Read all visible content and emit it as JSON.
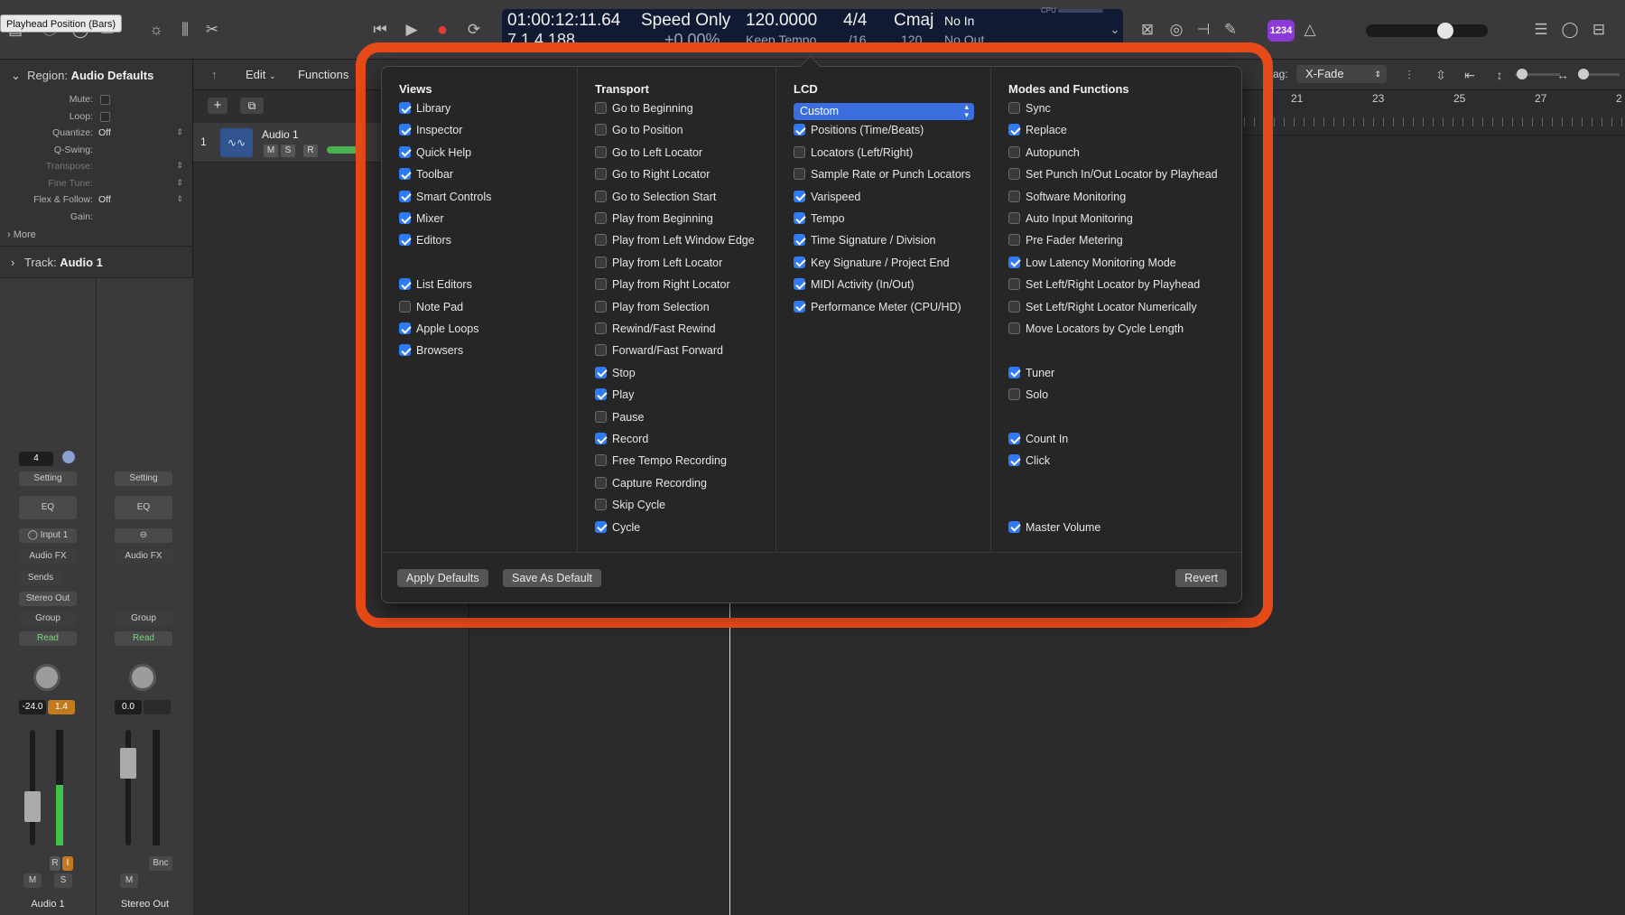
{
  "tooltip": "Playhead Position (Bars)",
  "lcd": {
    "time": "01:00:12:11.64",
    "speed": "Speed Only",
    "tempo": "120.0000",
    "signature": "4/4",
    "key": "Cmaj",
    "in_label": "No In",
    "bars": "7  1  4  188",
    "speed_sub": "+0.00%",
    "tempo_sub": "Keep Tempo",
    "division_sub": "/16",
    "key_sub": "120",
    "out_label": "No Out",
    "cpu_label": "CPU"
  },
  "topbar": {
    "count_badge": "1234"
  },
  "inspector": {
    "region_prefix": "Region:",
    "region_name": "Audio Defaults",
    "rows": [
      {
        "label": "Mute:",
        "value": "",
        "checkbox": true
      },
      {
        "label": "Loop:",
        "value": "",
        "checkbox": true
      },
      {
        "label": "Quantize:",
        "value": "Off"
      },
      {
        "label": "Q-Swing:",
        "value": ""
      },
      {
        "label": "Transpose:",
        "value": ""
      },
      {
        "label": "Fine Tune:",
        "value": ""
      },
      {
        "label": "Flex & Follow:",
        "value": "Off"
      },
      {
        "label": "Gain:",
        "value": ""
      }
    ],
    "more": "More",
    "track_prefix": "Track:",
    "track_name": "Audio 1"
  },
  "strips": {
    "left": {
      "value": "4",
      "setting": "Setting",
      "eq": "EQ",
      "input": "Input 1",
      "fx": "Audio FX",
      "sends": "Sends",
      "output": "Stereo Out",
      "group": "Group",
      "auto": "Read",
      "vol": "-24.0",
      "peak": "1.4",
      "r": "R",
      "i": "I",
      "m": "M",
      "s": "S",
      "name": "Audio 1"
    },
    "right": {
      "setting": "Setting",
      "eq": "EQ",
      "fx": "Audio FX",
      "group": "Group",
      "auto": "Read",
      "vol": "0.0",
      "bnc": "Bnc",
      "m": "M",
      "name": "Stereo Out"
    }
  },
  "tracks": {
    "edit": "Edit",
    "functions": "Functions",
    "row_number": "1",
    "track_name": "Audio 1",
    "m": "M",
    "s": "S",
    "r": "R",
    "drag_label": "rag:",
    "drag_value": "X-Fade",
    "ruler": [
      "21",
      "23",
      "25",
      "27",
      "2"
    ]
  },
  "dialog": {
    "views": {
      "title": "Views",
      "items": [
        {
          "label": "Library",
          "checked": true
        },
        {
          "label": "Inspector",
          "checked": true
        },
        {
          "label": "Quick Help",
          "checked": true
        },
        {
          "label": "Toolbar",
          "checked": true
        },
        {
          "label": "Smart Controls",
          "checked": true
        },
        {
          "label": "Mixer",
          "checked": true
        },
        {
          "label": "Editors",
          "checked": true
        },
        {
          "label": "",
          "checked": null
        },
        {
          "label": "List Editors",
          "checked": true
        },
        {
          "label": "Note Pad",
          "checked": false
        },
        {
          "label": "Apple Loops",
          "checked": true
        },
        {
          "label": "Browsers",
          "checked": true
        }
      ]
    },
    "transport": {
      "title": "Transport",
      "items": [
        {
          "label": "Go to Beginning",
          "checked": false
        },
        {
          "label": "Go to Position",
          "checked": false
        },
        {
          "label": "Go to Left Locator",
          "checked": false
        },
        {
          "label": "Go to Right Locator",
          "checked": false
        },
        {
          "label": "Go to Selection Start",
          "checked": false
        },
        {
          "label": "Play from Beginning",
          "checked": false
        },
        {
          "label": "Play from Left Window Edge",
          "checked": false
        },
        {
          "label": "Play from Left Locator",
          "checked": false
        },
        {
          "label": "Play from Right Locator",
          "checked": false
        },
        {
          "label": "Play from Selection",
          "checked": false
        },
        {
          "label": "Rewind/Fast Rewind",
          "checked": false
        },
        {
          "label": "Forward/Fast Forward",
          "checked": false
        },
        {
          "label": "Stop",
          "checked": true
        },
        {
          "label": "Play",
          "checked": true
        },
        {
          "label": "Pause",
          "checked": false
        },
        {
          "label": "Record",
          "checked": true
        },
        {
          "label": "Free Tempo Recording",
          "checked": false
        },
        {
          "label": "Capture Recording",
          "checked": false
        },
        {
          "label": "Skip Cycle",
          "checked": false
        },
        {
          "label": "Cycle",
          "checked": true
        }
      ]
    },
    "lcd": {
      "title": "LCD",
      "select_value": "Custom",
      "items": [
        {
          "label": "Positions (Time/Beats)",
          "checked": true
        },
        {
          "label": "Locators (Left/Right)",
          "checked": false
        },
        {
          "label": "Sample Rate or Punch Locators",
          "checked": false
        },
        {
          "label": "Varispeed",
          "checked": true
        },
        {
          "label": "Tempo",
          "checked": true
        },
        {
          "label": "Time Signature / Division",
          "checked": true
        },
        {
          "label": "Key Signature / Project End",
          "checked": true
        },
        {
          "label": "MIDI Activity (In/Out)",
          "checked": true
        },
        {
          "label": "Performance Meter (CPU/HD)",
          "checked": true
        }
      ]
    },
    "modes": {
      "title": "Modes and Functions",
      "items": [
        {
          "label": "Sync",
          "checked": false
        },
        {
          "label": "Replace",
          "checked": true
        },
        {
          "label": "Autopunch",
          "checked": false
        },
        {
          "label": "Set Punch In/Out Locator by Playhead",
          "checked": false
        },
        {
          "label": "Software Monitoring",
          "checked": false
        },
        {
          "label": "Auto Input Monitoring",
          "checked": false
        },
        {
          "label": "Pre Fader Metering",
          "checked": false
        },
        {
          "label": "Low Latency Monitoring Mode",
          "checked": true
        },
        {
          "label": "Set Left/Right Locator by Playhead",
          "checked": false
        },
        {
          "label": "Set Left/Right Locator Numerically",
          "checked": false
        },
        {
          "label": "Move Locators by Cycle Length",
          "checked": false
        },
        {
          "label": "",
          "checked": null
        },
        {
          "label": "Tuner",
          "checked": true
        },
        {
          "label": "Solo",
          "checked": false
        },
        {
          "label": "",
          "checked": null
        },
        {
          "label": "Count In",
          "checked": true
        },
        {
          "label": "Click",
          "checked": true
        },
        {
          "label": "",
          "checked": null
        },
        {
          "label": "",
          "checked": null
        },
        {
          "label": "Master Volume",
          "checked": true
        }
      ]
    },
    "buttons": {
      "apply_defaults": "Apply Defaults",
      "save_as_default": "Save As Default",
      "revert": "Revert"
    }
  },
  "colors": {
    "accent_highlight": "#e64a19",
    "checkbox_on": "#2f7bf5",
    "lcd_background": "#101a33",
    "record": "#e53935",
    "badge": "#8a3ad6",
    "automation_read": "#7fd37f"
  }
}
